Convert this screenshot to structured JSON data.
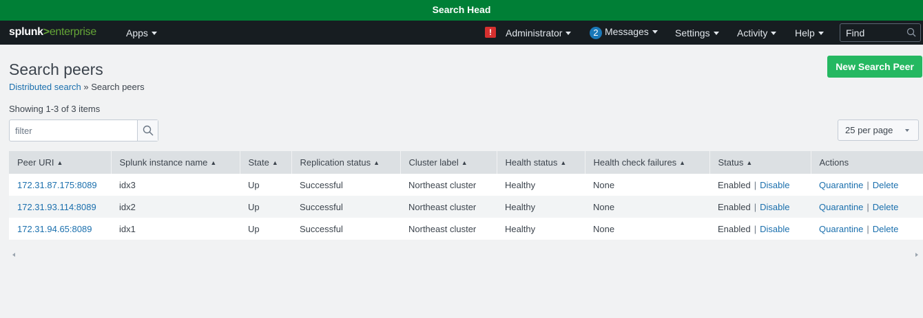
{
  "banner": {
    "title": "Search Head"
  },
  "navbar": {
    "logo_word": "splunk",
    "logo_mark": ">",
    "logo_product": "enterprise",
    "apps_label": "Apps",
    "alert_glyph": "!",
    "admin_label": "Administrator",
    "messages_count": "2",
    "messages_label": "Messages",
    "settings_label": "Settings",
    "activity_label": "Activity",
    "help_label": "Help",
    "find_placeholder": "Find"
  },
  "page": {
    "title": "Search peers",
    "breadcrumb_link": "Distributed search",
    "breadcrumb_sep": "»",
    "breadcrumb_current": "Search peers",
    "new_button": "New Search Peer",
    "showing": "Showing 1-3 of 3 items",
    "filter_placeholder": "filter",
    "per_page": "25 per page"
  },
  "table": {
    "columns": [
      {
        "label": "Peer URI",
        "sortable": true
      },
      {
        "label": "Splunk instance name",
        "sortable": true
      },
      {
        "label": "State",
        "sortable": true
      },
      {
        "label": "Replication status",
        "sortable": true
      },
      {
        "label": "Cluster label",
        "sortable": true
      },
      {
        "label": "Health status",
        "sortable": true
      },
      {
        "label": "Health check failures",
        "sortable": true
      },
      {
        "label": "Status",
        "sortable": true
      },
      {
        "label": "Actions",
        "sortable": false
      }
    ],
    "rows": [
      {
        "uri": "172.31.87.175:8089",
        "instance": "idx3",
        "state": "Up",
        "replication": "Successful",
        "cluster": "Northeast cluster",
        "health": "Healthy",
        "failures": "None",
        "status": "Enabled",
        "status_action": "Disable",
        "action1": "Quarantine",
        "action2": "Delete"
      },
      {
        "uri": "172.31.93.114:8089",
        "instance": "idx2",
        "state": "Up",
        "replication": "Successful",
        "cluster": "Northeast cluster",
        "health": "Healthy",
        "failures": "None",
        "status": "Enabled",
        "status_action": "Disable",
        "action1": "Quarantine",
        "action2": "Delete"
      },
      {
        "uri": "172.31.94.65:8089",
        "instance": "idx1",
        "state": "Up",
        "replication": "Successful",
        "cluster": "Northeast cluster",
        "health": "Healthy",
        "failures": "None",
        "status": "Enabled",
        "status_action": "Disable",
        "action1": "Quarantine",
        "action2": "Delete"
      }
    ],
    "separator": "|"
  },
  "icons": {
    "alert": "alert-icon",
    "search": "search-icon",
    "sort": "sort-icon",
    "caret": "chevron-down-icon"
  },
  "colors": {
    "banner": "#007f36",
    "navbar": "#171d21",
    "primary_button": "#25b861",
    "link": "#1a6fad",
    "alert": "#d6302f",
    "badge": "#1a78b8"
  }
}
